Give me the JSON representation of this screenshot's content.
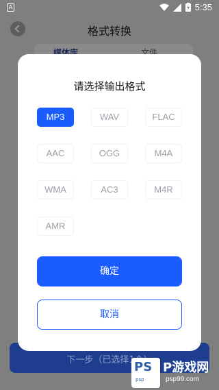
{
  "status_bar": {
    "left_icon": "A",
    "time": "5:35",
    "icons": [
      "wifi-icon",
      "signal-icon",
      "battery-charging-icon"
    ]
  },
  "page": {
    "title": "格式转换",
    "tabs": [
      {
        "label": "媒体库"
      },
      {
        "label": "文件"
      }
    ],
    "bottom_button": "下一步（已选择1个）"
  },
  "dialog": {
    "title": "请选择输出格式",
    "formats": [
      {
        "label": "MP3",
        "selected": true
      },
      {
        "label": "WAV",
        "selected": false
      },
      {
        "label": "FLAC",
        "selected": false
      },
      {
        "label": "AAC",
        "selected": false
      },
      {
        "label": "OGG",
        "selected": false
      },
      {
        "label": "M4A",
        "selected": false
      },
      {
        "label": "WMA",
        "selected": false
      },
      {
        "label": "AC3",
        "selected": false
      },
      {
        "label": "M4R",
        "selected": false
      },
      {
        "label": "AMR",
        "selected": false
      }
    ],
    "confirm_label": "确定",
    "cancel_label": "取消"
  },
  "watermark": {
    "logo_text": "PS",
    "logo_sub": "psp",
    "site_name": "P游戏网",
    "url": "psp99.com"
  },
  "colors": {
    "accent": "#1a5cff",
    "overlay": "#7f7f7f"
  }
}
